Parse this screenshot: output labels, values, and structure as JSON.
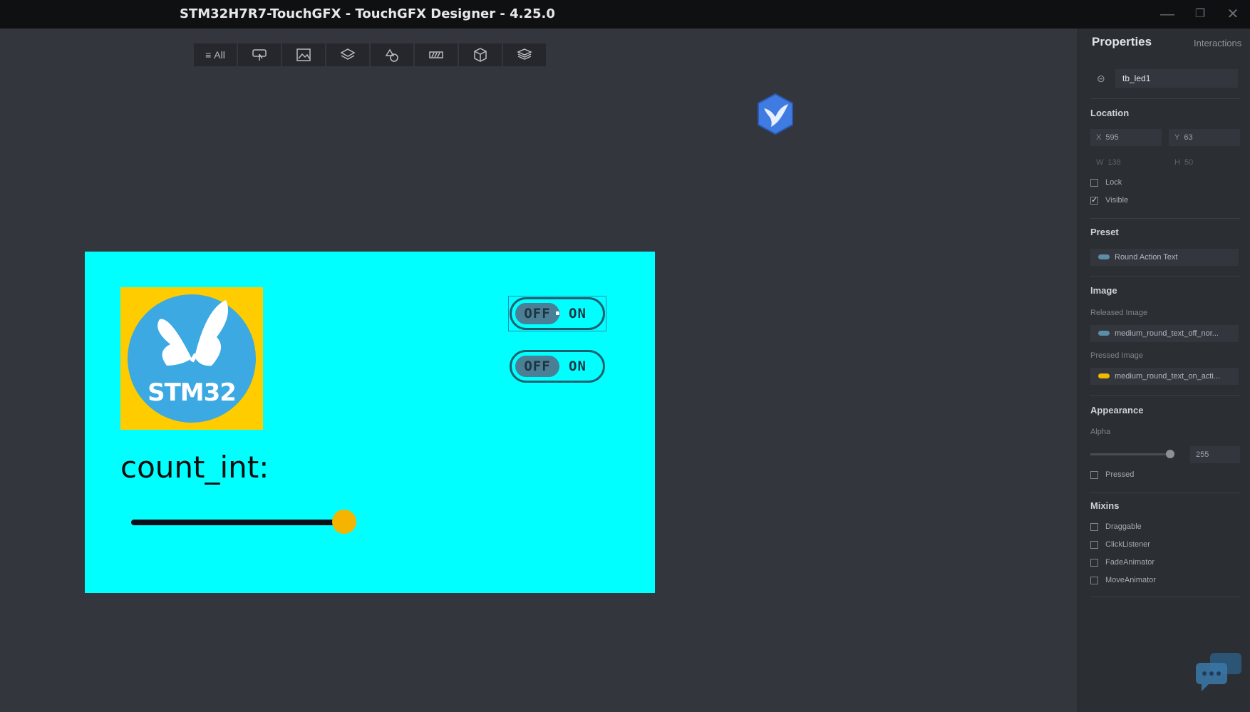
{
  "window": {
    "title": "STM32H7R7-TouchGFX - TouchGFX Designer - 4.25.0"
  },
  "toolbar": {
    "all_label": "All"
  },
  "screen": {
    "background": "#00ffff",
    "logo_text": "STM32",
    "count_label": "count_int:",
    "toggle_off": "OFF",
    "toggle_on": "ON"
  },
  "properties": {
    "tab_properties": "Properties",
    "tab_interactions": "Interactions",
    "widget_name": "tb_led1",
    "location": {
      "header": "Location",
      "x_label": "X",
      "x": "595",
      "y_label": "Y",
      "y": "63",
      "w_label": "W",
      "w": "138",
      "h_label": "H",
      "h": "50",
      "lock": "Lock",
      "visible": "Visible"
    },
    "preset": {
      "header": "Preset",
      "value": "Round Action Text"
    },
    "image": {
      "header": "Image",
      "released_label": "Released Image",
      "released_value": "medium_round_text_off_nor...",
      "pressed_label": "Pressed Image",
      "pressed_value": "medium_round_text_on_acti..."
    },
    "appearance": {
      "header": "Appearance",
      "alpha_label": "Alpha",
      "alpha": "255",
      "pressed": "Pressed"
    },
    "mixins": {
      "header": "Mixins",
      "items": [
        "Draggable",
        "ClickListener",
        "FadeAnimator",
        "MoveAnimator"
      ]
    }
  }
}
